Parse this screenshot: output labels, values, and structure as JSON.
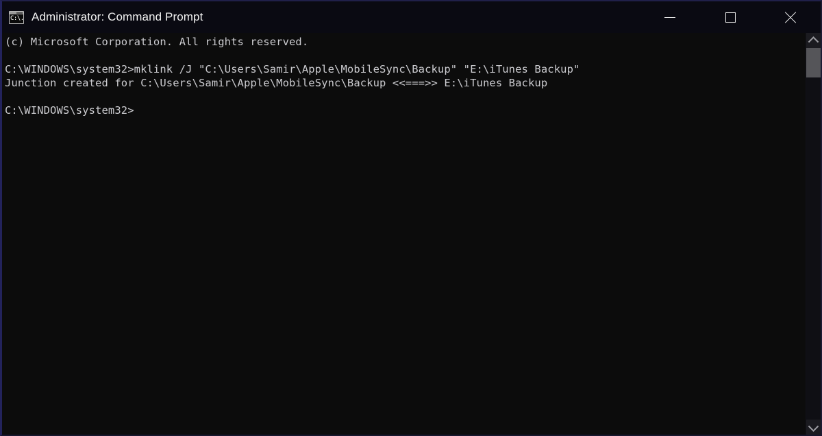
{
  "window": {
    "title": "Administrator: Command Prompt",
    "icon": "cmd-console-icon",
    "icon_glyph": "C:\\.",
    "background_color": "#0c0c0c",
    "titlebar_color": "#0a0a12",
    "border_color": "#23235c",
    "text_color": "#ccccd0",
    "controls": {
      "minimize_label": "Minimize",
      "maximize_label": "Maximize",
      "close_label": "Close"
    }
  },
  "console": {
    "lines": [
      "(c) Microsoft Corporation. All rights reserved.",
      "",
      "C:\\WINDOWS\\system32>mklink /J \"C:\\Users\\Samir\\Apple\\MobileSync\\Backup\" \"E:\\iTunes Backup\"",
      "Junction created for C:\\Users\\Samir\\Apple\\MobileSync\\Backup <<===>> E:\\iTunes Backup",
      "",
      "C:\\WINDOWS\\system32>"
    ],
    "prompt": "C:\\WINDOWS\\system32>",
    "command": "mklink /J \"C:\\Users\\Samir\\Apple\\MobileSync\\Backup\" \"E:\\iTunes Backup\"",
    "result": "Junction created for C:\\Users\\Samir\\Apple\\MobileSync\\Backup <<===>> E:\\iTunes Backup",
    "copyright": "(c) Microsoft Corporation. All rights reserved."
  },
  "scrollbar": {
    "up_arrow": "chevron-up-icon",
    "down_arrow": "chevron-down-icon",
    "thumb_color": "#555559",
    "track_color": "#0f0f14"
  }
}
